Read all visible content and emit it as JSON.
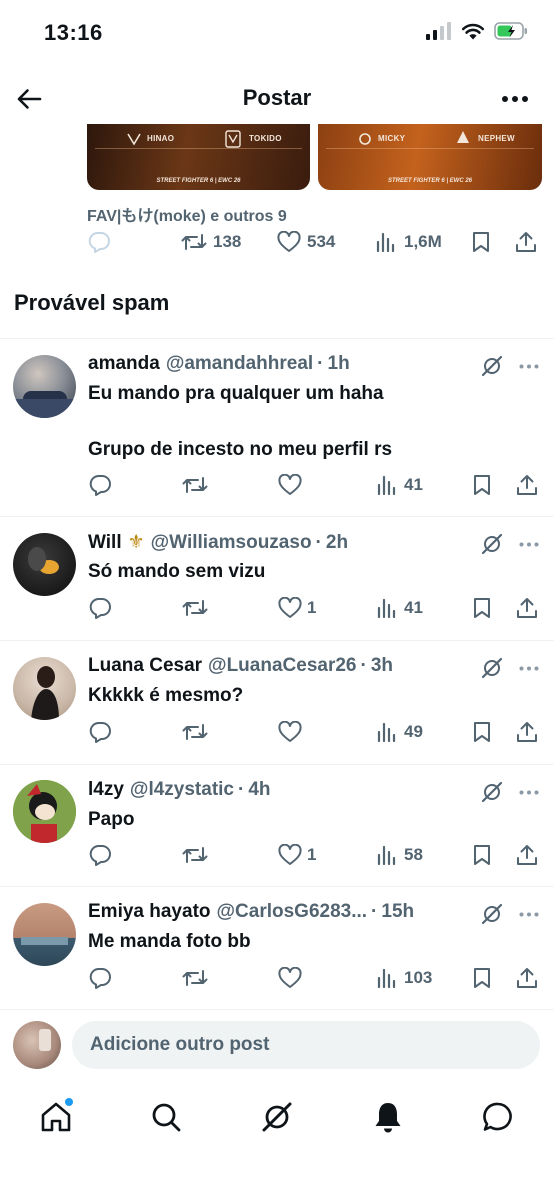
{
  "status_bar": {
    "time": "13:16"
  },
  "header": {
    "title": "Postar"
  },
  "media": {
    "card1": {
      "left_player": "HINAO",
      "right_player": "TOKIDO",
      "footer": "STREET FIGHTER 6 | EWC 26"
    },
    "card2": {
      "left_player": "MICKY",
      "right_player": "NEPHEW",
      "footer": "STREET FIGHTER 6 | EWC 26"
    }
  },
  "post": {
    "liked_by": "FAV|もけ(moke) e outros 9",
    "reposts": "138",
    "likes": "534",
    "views": "1,6M"
  },
  "section": {
    "title": "Provável spam"
  },
  "replies": [
    {
      "name": "amanda",
      "handle": "@amandahhreal",
      "time": "1h",
      "text": "Eu mando pra qualquer um haha\n\nGrupo de incesto no meu perfil rs",
      "likes": "",
      "views": "41"
    },
    {
      "name": "Will",
      "badge": "⚜",
      "handle": "@Williamsouzaso",
      "time": "2h",
      "text": "Só mando sem vizu",
      "likes": "1",
      "views": "41"
    },
    {
      "name": "Luana Cesar",
      "handle": "@LuanaCesar26",
      "time": "3h",
      "text": "Kkkkk é mesmo?",
      "likes": "",
      "views": "49"
    },
    {
      "name": "l4zy",
      "handle": "@l4zystatic",
      "time": "4h",
      "text": "Papo",
      "likes": "1",
      "views": "58"
    },
    {
      "name": "Emiya hayato",
      "handle": "@CarlosG6283...",
      "time": "15h",
      "text": "Me manda foto bb",
      "likes": "",
      "views": "103"
    }
  ],
  "compose": {
    "placeholder": "Adicione outro post"
  },
  "colors": {
    "accent": "#1d9bf0",
    "text": "#0f1419",
    "secondary": "#536471"
  }
}
